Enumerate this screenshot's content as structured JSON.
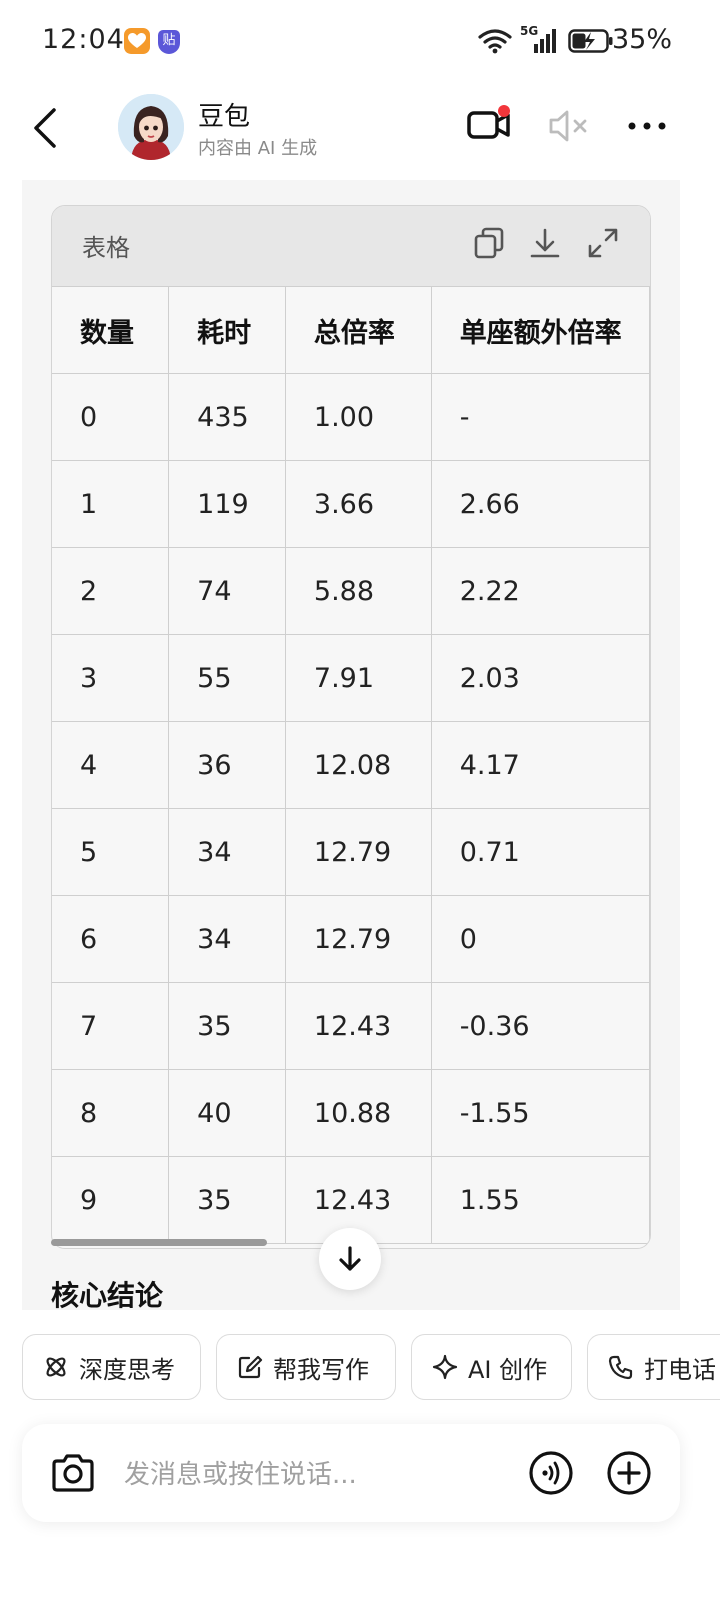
{
  "status_bar": {
    "time": "12:04",
    "app_badge": "贴",
    "network": "5G",
    "battery": "35%"
  },
  "header": {
    "name": "豆包",
    "subtitle": "内容由 AI 生成"
  },
  "table_card": {
    "title": "表格",
    "columns": [
      "数量",
      "耗时",
      "总倍率",
      "单座额外倍率"
    ],
    "rows": [
      [
        "0",
        "435",
        "1.00",
        "-"
      ],
      [
        "1",
        "119",
        "3.66",
        "2.66"
      ],
      [
        "2",
        "74",
        "5.88",
        "2.22"
      ],
      [
        "3",
        "55",
        "7.91",
        "2.03"
      ],
      [
        "4",
        "36",
        "12.08",
        "4.17"
      ],
      [
        "5",
        "34",
        "12.79",
        "0.71"
      ],
      [
        "6",
        "34",
        "12.79",
        "0"
      ],
      [
        "7",
        "35",
        "12.43",
        "-0.36"
      ],
      [
        "8",
        "40",
        "10.88",
        "-1.55"
      ],
      [
        "9",
        "35",
        "12.43",
        "1.55"
      ]
    ]
  },
  "section_title": "核心结论",
  "chips": [
    {
      "label": "深度思考",
      "icon": "atom-icon"
    },
    {
      "label": "帮我写作",
      "icon": "edit-icon"
    },
    {
      "label": "AI 创作",
      "icon": "sparkle-icon"
    },
    {
      "label": "打电话",
      "icon": "phone-icon"
    }
  ],
  "input": {
    "placeholder": "发消息或按住说话..."
  }
}
